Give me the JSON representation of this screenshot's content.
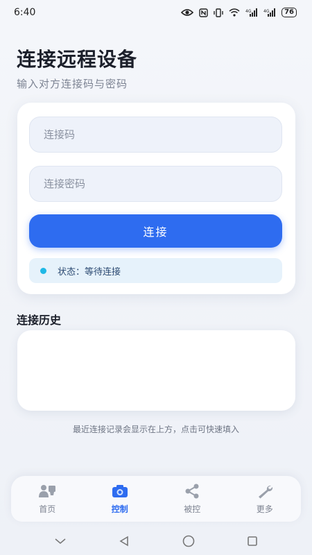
{
  "status_bar": {
    "time": "6:40",
    "battery": "76"
  },
  "header": {
    "title": "连接远程设备",
    "subtitle": "输入对方连接码与密码"
  },
  "form": {
    "code_placeholder": "连接码",
    "password_placeholder": "连接密码",
    "connect_label": "连接",
    "status_text": "状态：等待连接",
    "status_color": "#1fb8e6"
  },
  "history": {
    "title": "连接历史",
    "hint": "最近连接记录会显示在上方，点击可快速填入"
  },
  "tabbar": {
    "accent": "#2e6cf0",
    "tabs": [
      {
        "label": "首页",
        "icon": "people-icon"
      },
      {
        "label": "控制",
        "icon": "camera-icon"
      },
      {
        "label": "被控",
        "icon": "share-icon"
      },
      {
        "label": "更多",
        "icon": "wrench-icon"
      }
    ],
    "active_index": 1
  }
}
